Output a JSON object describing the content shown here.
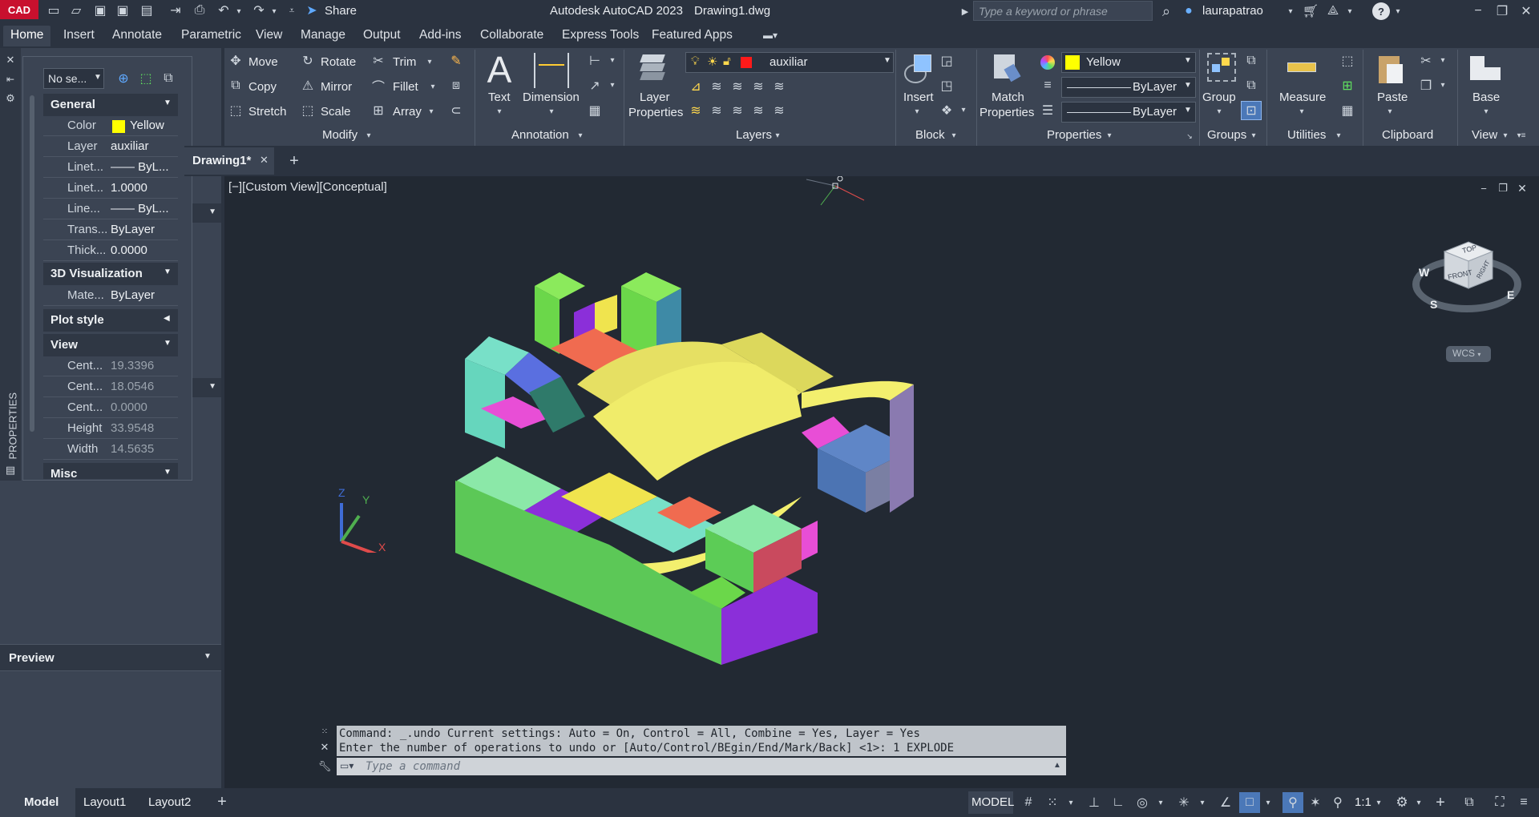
{
  "titlebar": {
    "logo": "CAD",
    "share": "Share",
    "app_title": "Autodesk AutoCAD 2023",
    "doc_title": "Drawing1.dwg",
    "search_placeholder": "Type a keyword or phrase",
    "user": "laurapatrao"
  },
  "ribbon_tabs": [
    "Home",
    "Insert",
    "Annotate",
    "Parametric",
    "View",
    "Manage",
    "Output",
    "Add-ins",
    "Collaborate",
    "Express Tools",
    "Featured Apps"
  ],
  "modify": {
    "title": "Modify",
    "move": "Move",
    "rotate": "Rotate",
    "trim": "Trim",
    "copy": "Copy",
    "mirror": "Mirror",
    "fillet": "Fillet",
    "stretch": "Stretch",
    "scale": "Scale",
    "array": "Array"
  },
  "annotation": {
    "title": "Annotation",
    "text": "Text",
    "dimension": "Dimension"
  },
  "layers": {
    "title": "Layers",
    "layer_props_1": "Layer",
    "layer_props_2": "Properties",
    "current_layer": "auxiliar",
    "layer_color": "#ff1a1a"
  },
  "block": {
    "title": "Block",
    "insert": "Insert"
  },
  "properties": {
    "title": "Properties",
    "match_1": "Match",
    "match_2": "Properties",
    "color_value": "Yellow",
    "color_hex": "#ffff00",
    "linetype": "ByLayer",
    "lineweight": "ByLayer"
  },
  "groups": {
    "title": "Groups",
    "group": "Group"
  },
  "utilities": {
    "title": "Utilities",
    "measure": "Measure"
  },
  "clipboard": {
    "title": "Clipboard",
    "paste": "Paste"
  },
  "view_panel": {
    "title": "View",
    "base": "Base"
  },
  "palette": {
    "selection": "No se...",
    "vertical_title": "PROPERTIES",
    "general": "General",
    "rows": [
      {
        "k": "Color",
        "v": "Yellow"
      },
      {
        "k": "Layer",
        "v": "auxiliar"
      },
      {
        "k": "Linet...",
        "v": "—— ByL..."
      },
      {
        "k": "Linet...",
        "v": "1.0000"
      },
      {
        "k": "Line...",
        "v": "—— ByL..."
      },
      {
        "k": "Trans...",
        "v": "ByLayer"
      },
      {
        "k": "Thick...",
        "v": "0.0000"
      }
    ],
    "viz": "3D Visualization",
    "mat_k": "Mate...",
    "mat_v": "ByLayer",
    "plot": "Plot style",
    "view": "View",
    "view_rows": [
      {
        "k": "Cent...",
        "v": "19.3396"
      },
      {
        "k": "Cent...",
        "v": "18.0546"
      },
      {
        "k": "Cent...",
        "v": "0.0000"
      },
      {
        "k": "Height",
        "v": "33.9548"
      },
      {
        "k": "Width",
        "v": "14.5635"
      }
    ],
    "misc": "Misc"
  },
  "preview": "Preview",
  "doc_tab": "Drawing1*",
  "viewport_label": "[−][Custom View][Conceptual]",
  "viewcube": {
    "top": "TOP",
    "front": "FRONT",
    "right": "RIGHT",
    "w": "W",
    "s": "S",
    "e": "E",
    "wcs": "WCS"
  },
  "ucs": {
    "z": "Z",
    "y": "Y",
    "x": "X"
  },
  "command": {
    "line1": "Command: _.undo Current settings: Auto = On, Control = All, Combine = Yes, Layer = Yes",
    "line2": "Enter the number of operations to undo or [Auto/Control/BEgin/End/Mark/Back] <1>: 1 EXPLODE",
    "placeholder": "Type a command"
  },
  "layout_tabs": [
    "Model",
    "Layout1",
    "Layout2"
  ],
  "status": {
    "model": "MODEL",
    "scale": "1:1"
  }
}
